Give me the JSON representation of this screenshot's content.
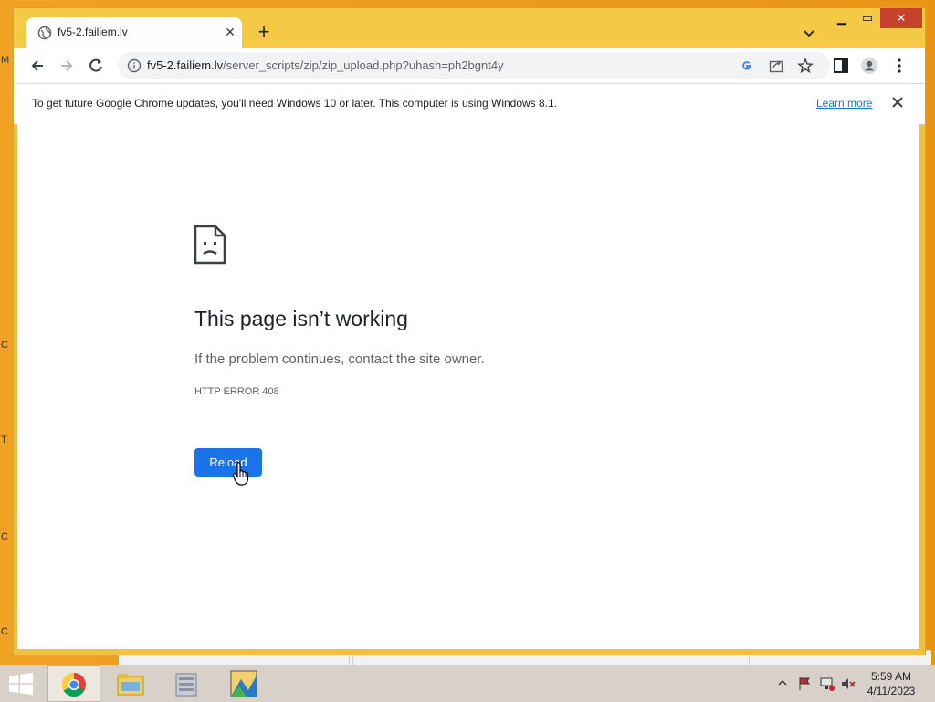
{
  "tab": {
    "title": "fv5-2.failiem.lv"
  },
  "address_bar": {
    "host": "fv5-2.failiem.lv",
    "path": "/server_scripts/zip/zip_upload.php?uhash=ph2bgnt4y"
  },
  "infobar": {
    "message": "To get future Google Chrome updates, you'll need Windows 10 or later. This computer is using Windows 8.1.",
    "link": "Learn more"
  },
  "error_page": {
    "title": "This page isn’t working",
    "subtitle": "If the problem continues, contact the site owner.",
    "code": "HTTP ERROR 408",
    "reload_label": "Reload"
  },
  "desktop_edge_chars": [
    "M",
    "C",
    "T",
    "C",
    "C"
  ],
  "taskbar": {
    "apps": [
      "chrome-app",
      "file-explorer-app",
      "archive-app",
      "paint-app"
    ],
    "clock": {
      "time": "5:59 AM",
      "date": "4/11/2023"
    }
  },
  "colors": {
    "accent": "#1a73e8",
    "titlebar": "#f4c945",
    "close": "#c7412e"
  }
}
